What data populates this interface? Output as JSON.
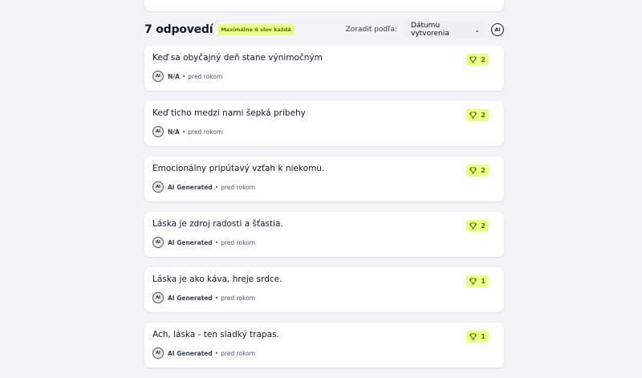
{
  "header": {
    "count_label": "7 odpovedí",
    "badge": "Maximálne 6 slov každá",
    "sort_label": "Zoradiť podľa:",
    "sort_value": "Dátumu vytvorenia",
    "ai_button": "AI"
  },
  "colors": {
    "accent": "#eaff86",
    "accent_text": "#5a6e00"
  },
  "answers": [
    {
      "text": "Keď sa obyčajný deň stane výnimočným",
      "author": "N/A",
      "time": "pred rokom",
      "votes": "2"
    },
    {
      "text": "Keď ticho medzi nami šepká príbehy",
      "author": "N/A",
      "time": "pred rokom",
      "votes": "2"
    },
    {
      "text": "Emocionálny pripútavý vzťah k niekomu.",
      "author": "AI Generated",
      "time": "pred rokom",
      "votes": "2"
    },
    {
      "text": "Láska je zdroj radosti a šťastia.",
      "author": "AI Generated",
      "time": "pred rokom",
      "votes": "2"
    },
    {
      "text": "Láska je ako káva, hreje srdce.",
      "author": "AI Generated",
      "time": "pred rokom",
      "votes": "1"
    },
    {
      "text": "Ach, láska - ten sladký trapas.",
      "author": "AI Generated",
      "time": "pred rokom",
      "votes": "1"
    }
  ],
  "avatar_label": "AI",
  "separator": "•"
}
